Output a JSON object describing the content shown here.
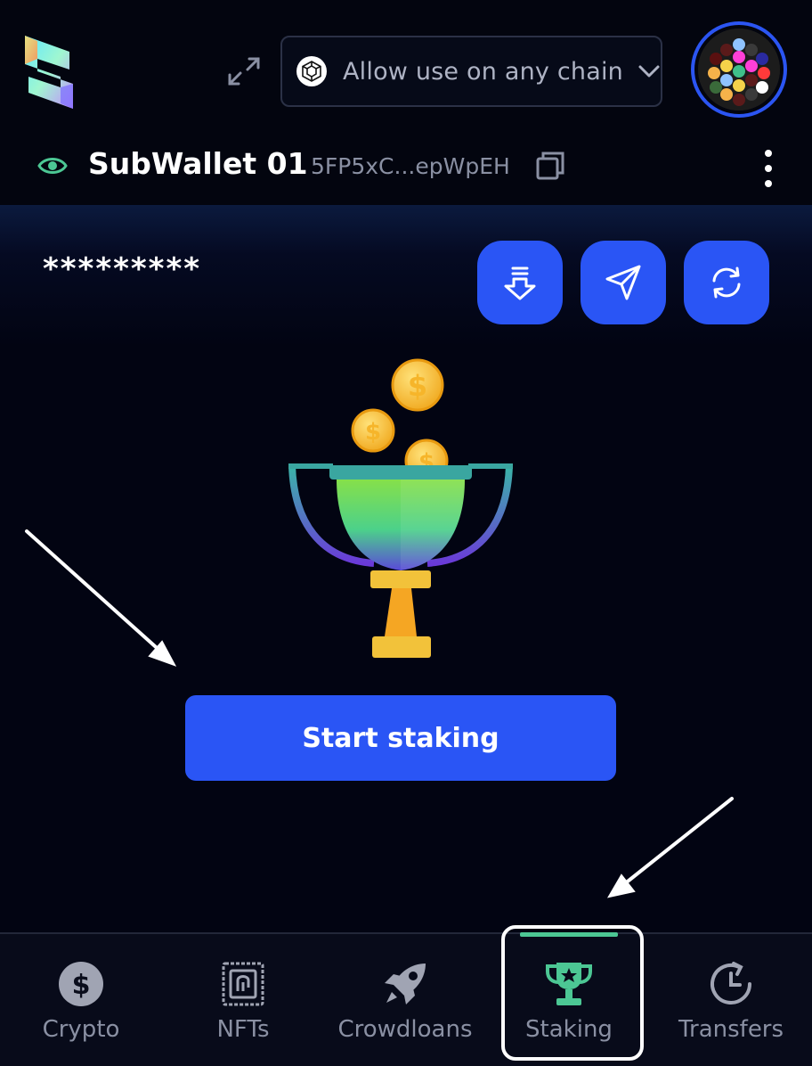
{
  "header": {
    "chain_selector_label": "Allow use on any chain"
  },
  "account": {
    "name": "SubWallet 01",
    "address": "5FP5xC...epWpEH"
  },
  "balance": {
    "masked_value": "*********"
  },
  "actions": [
    {
      "icon": "receive-icon"
    },
    {
      "icon": "send-icon"
    },
    {
      "icon": "swap-icon"
    }
  ],
  "main": {
    "start_button_label": "Start staking"
  },
  "nav": {
    "items": [
      {
        "label": "Crypto",
        "icon": "dollar-coin-icon"
      },
      {
        "label": "NFTs",
        "icon": "nft-icon"
      },
      {
        "label": "Crowdloans",
        "icon": "rocket-icon"
      },
      {
        "label": "Staking",
        "icon": "trophy-icon",
        "active": true
      },
      {
        "label": "Transfers",
        "icon": "history-icon"
      }
    ]
  },
  "colors": {
    "background": "#020412",
    "accent": "#2a55f5",
    "active_tab": "#4cc794",
    "eye": "#4cc794"
  }
}
